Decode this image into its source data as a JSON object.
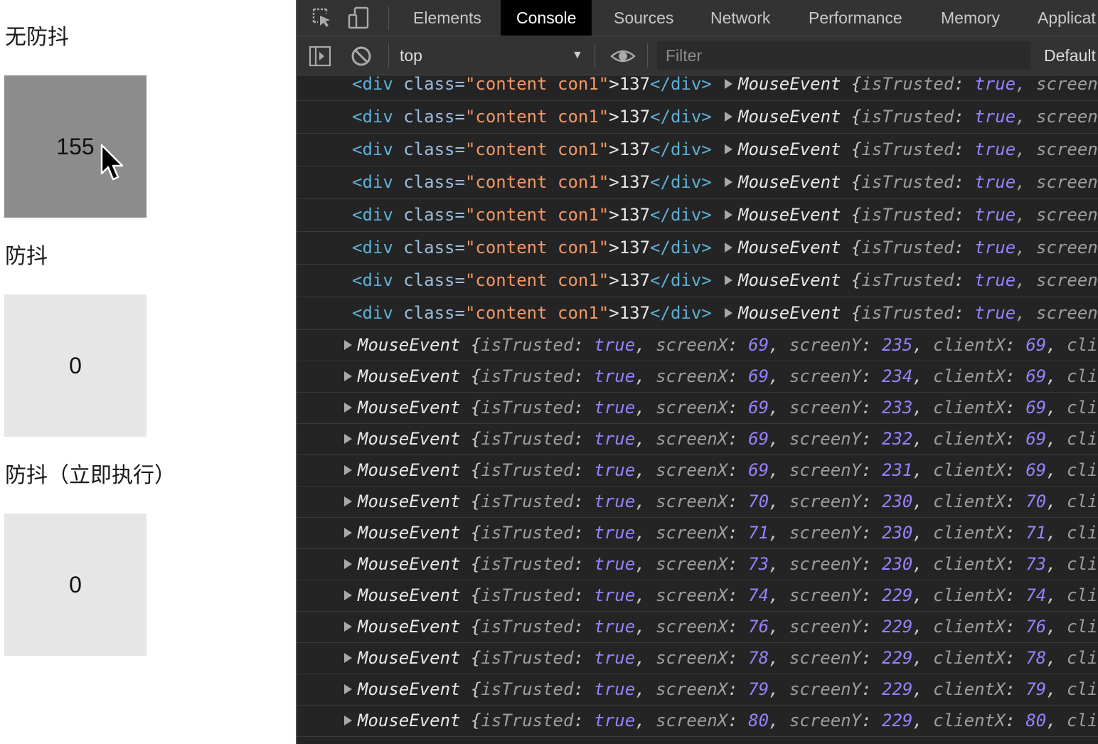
{
  "demo": {
    "sections": [
      {
        "title": "无防抖",
        "count": "155",
        "state": "active"
      },
      {
        "title": "防抖",
        "count": "0",
        "state": "idle"
      },
      {
        "title": "防抖（立即执行）",
        "count": "0",
        "state": "idle"
      }
    ]
  },
  "devtools": {
    "tabs": [
      "Elements",
      "Console",
      "Sources",
      "Network",
      "Performance",
      "Memory",
      "Applicat"
    ],
    "active_tab": "Console",
    "toolbar": {
      "context": "top",
      "filter_placeholder": "Filter",
      "levels_label": "Default"
    },
    "element_logs": [
      {
        "html_open": "<div",
        "attr": "class=",
        "attr_value": "\"content con1\"",
        "text": ">137",
        "html_close": "</div>",
        "event": "MouseEvent",
        "brace": "{",
        "key1": "isTrusted",
        "val1": "true",
        "trail": ", screen"
      },
      {
        "html_open": "<div",
        "attr": "class=",
        "attr_value": "\"content con1\"",
        "text": ">137",
        "html_close": "</div>",
        "event": "MouseEvent",
        "brace": "{",
        "key1": "isTrusted",
        "val1": "true",
        "trail": ", screen"
      },
      {
        "html_open": "<div",
        "attr": "class=",
        "attr_value": "\"content con1\"",
        "text": ">137",
        "html_close": "</div>",
        "event": "MouseEvent",
        "brace": "{",
        "key1": "isTrusted",
        "val1": "true",
        "trail": ", screen"
      },
      {
        "html_open": "<div",
        "attr": "class=",
        "attr_value": "\"content con1\"",
        "text": ">137",
        "html_close": "</div>",
        "event": "MouseEvent",
        "brace": "{",
        "key1": "isTrusted",
        "val1": "true",
        "trail": ", screen"
      },
      {
        "html_open": "<div",
        "attr": "class=",
        "attr_value": "\"content con1\"",
        "text": ">137",
        "html_close": "</div>",
        "event": "MouseEvent",
        "brace": "{",
        "key1": "isTrusted",
        "val1": "true",
        "trail": ", screen"
      },
      {
        "html_open": "<div",
        "attr": "class=",
        "attr_value": "\"content con1\"",
        "text": ">137",
        "html_close": "</div>",
        "event": "MouseEvent",
        "brace": "{",
        "key1": "isTrusted",
        "val1": "true",
        "trail": ", screen"
      },
      {
        "html_open": "<div",
        "attr": "class=",
        "attr_value": "\"content con1\"",
        "text": ">137",
        "html_close": "</div>",
        "event": "MouseEvent",
        "brace": "{",
        "key1": "isTrusted",
        "val1": "true",
        "trail": ", screen"
      },
      {
        "html_open": "<div",
        "attr": "class=",
        "attr_value": "\"content con1\"",
        "text": ">137",
        "html_close": "</div>",
        "event": "MouseEvent",
        "brace": "{",
        "key1": "isTrusted",
        "val1": "true",
        "trail": ", screen"
      }
    ],
    "event_logs": [
      {
        "event": "MouseEvent",
        "isTrusted": "true",
        "screenX": "69",
        "screenY": "235",
        "clientX": "69",
        "trail": "cli"
      },
      {
        "event": "MouseEvent",
        "isTrusted": "true",
        "screenX": "69",
        "screenY": "234",
        "clientX": "69",
        "trail": "cli"
      },
      {
        "event": "MouseEvent",
        "isTrusted": "true",
        "screenX": "69",
        "screenY": "233",
        "clientX": "69",
        "trail": "cli"
      },
      {
        "event": "MouseEvent",
        "isTrusted": "true",
        "screenX": "69",
        "screenY": "232",
        "clientX": "69",
        "trail": "cli"
      },
      {
        "event": "MouseEvent",
        "isTrusted": "true",
        "screenX": "69",
        "screenY": "231",
        "clientX": "69",
        "trail": "cli"
      },
      {
        "event": "MouseEvent",
        "isTrusted": "true",
        "screenX": "70",
        "screenY": "230",
        "clientX": "70",
        "trail": "cli"
      },
      {
        "event": "MouseEvent",
        "isTrusted": "true",
        "screenX": "71",
        "screenY": "230",
        "clientX": "71",
        "trail": "cli"
      },
      {
        "event": "MouseEvent",
        "isTrusted": "true",
        "screenX": "73",
        "screenY": "230",
        "clientX": "73",
        "trail": "cli"
      },
      {
        "event": "MouseEvent",
        "isTrusted": "true",
        "screenX": "74",
        "screenY": "229",
        "clientX": "74",
        "trail": "cli"
      },
      {
        "event": "MouseEvent",
        "isTrusted": "true",
        "screenX": "76",
        "screenY": "229",
        "clientX": "76",
        "trail": "cli"
      },
      {
        "event": "MouseEvent",
        "isTrusted": "true",
        "screenX": "78",
        "screenY": "229",
        "clientX": "78",
        "trail": "cli"
      },
      {
        "event": "MouseEvent",
        "isTrusted": "true",
        "screenX": "79",
        "screenY": "229",
        "clientX": "79",
        "trail": "cli"
      },
      {
        "event": "MouseEvent",
        "isTrusted": "true",
        "screenX": "80",
        "screenY": "229",
        "clientX": "80",
        "trail": "cli"
      }
    ],
    "keys": {
      "isTrusted": "isTrusted",
      "screenX": "screenX",
      "screenY": "screenY",
      "clientX": "clientX"
    }
  },
  "icons": {
    "inspect": "inspect-element-icon",
    "device": "device-toolbar-icon",
    "sidebar": "show-sidebar-icon",
    "clear": "clear-console-icon",
    "eye": "live-expression-eye-icon",
    "cursor": "mouse-cursor-icon"
  }
}
